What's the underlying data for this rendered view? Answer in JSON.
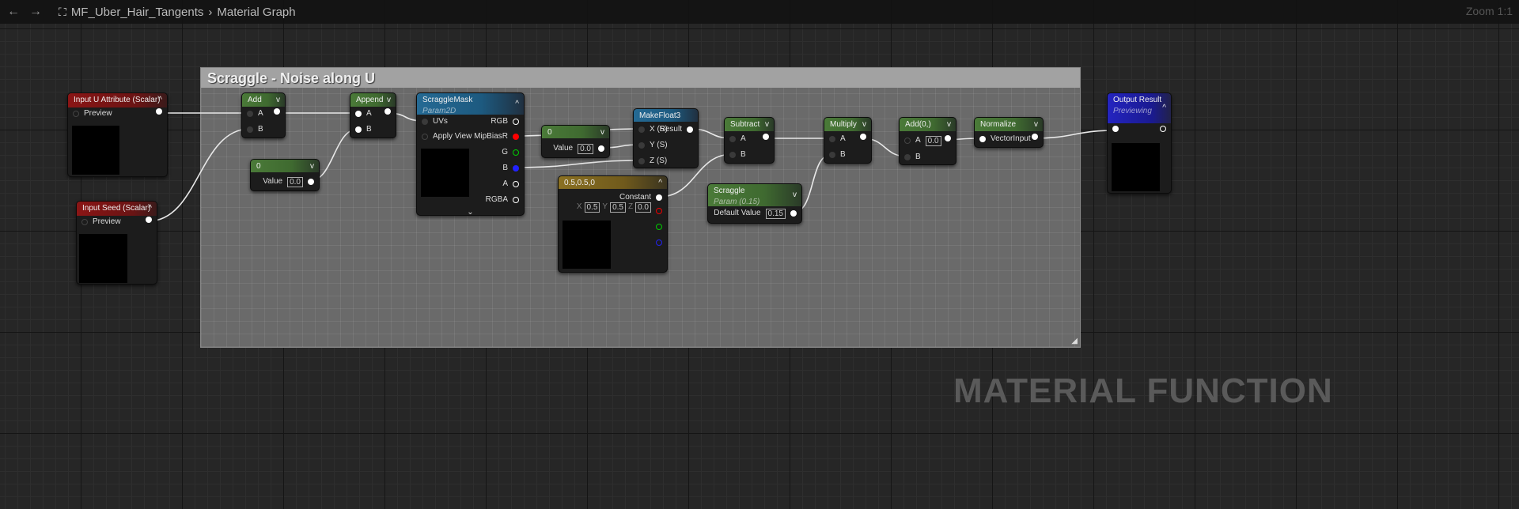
{
  "topbar": {
    "back_icon": "arrow-left",
    "forward_icon": "arrow-right",
    "graph_icon": "material-graph-icon",
    "asset": "MF_Uber_Hair_Tangents",
    "separator": "›",
    "graph": "Material Graph",
    "zoom": "Zoom 1:1"
  },
  "comment": {
    "title": "Scraggle - Noise along U"
  },
  "watermark": "MATERIAL FUNCTION",
  "colors": {
    "function_input": "#8a1515",
    "math": "#4a7a38",
    "texture_param": "#256a94",
    "constant3": "#8a7022",
    "output": "#2424c0"
  },
  "nodes": [
    {
      "id": "inU",
      "title": "Input U Attribute (Scalar)",
      "color": "red",
      "chev": "^",
      "preview": true,
      "rows": [
        {
          "l": {
            "pin": "empty",
            "label": "Preview"
          },
          "r": {
            "pin": "filled"
          }
        }
      ]
    },
    {
      "id": "inSeed",
      "title": "Input Seed (Scalar)",
      "color": "red",
      "chev": "^",
      "preview": true,
      "rows": [
        {
          "l": {
            "pin": "empty",
            "label": "Preview"
          },
          "r": {
            "pin": "filled"
          }
        }
      ]
    },
    {
      "id": "add",
      "title": "Add",
      "color": "green",
      "chev": "v",
      "rows": [
        {
          "l": {
            "pin": "dim",
            "label": "A"
          },
          "r": {
            "pin": "filled"
          }
        },
        {
          "l": {
            "pin": "dim",
            "label": "B"
          }
        }
      ]
    },
    {
      "id": "c0a",
      "title": "0",
      "color": "green",
      "chev": "v",
      "rows": [
        {
          "r": {
            "label": "Value",
            "value": "0.0",
            "pin": "filled"
          }
        }
      ]
    },
    {
      "id": "append",
      "title": "Append",
      "color": "green",
      "chev": "v",
      "rows": [
        {
          "l": {
            "pin": "filled",
            "label": "A"
          },
          "r": {
            "pin": "filled"
          }
        },
        {
          "l": {
            "pin": "filled",
            "label": "B"
          }
        }
      ]
    },
    {
      "id": "mask",
      "title": "ScraggleMask",
      "subtitle": "Param2D",
      "color": "blue",
      "chev": "^",
      "preview": true,
      "foot": "⌄",
      "rows": [
        {
          "l": {
            "pin": "dim",
            "label": "UVs"
          },
          "r": {
            "label": "RGB",
            "pin": "hollow"
          }
        },
        {
          "l": {
            "pin": "empty",
            "label": "Apply View MipBias"
          },
          "r": {
            "label": "R",
            "pin": "red"
          }
        },
        {
          "r": {
            "label": "G",
            "pin": "green-h"
          }
        },
        {
          "r": {
            "label": "B",
            "pin": "blue"
          }
        },
        {
          "r": {
            "label": "A",
            "pin": "hollow"
          }
        },
        {
          "r": {
            "label": "RGBA",
            "pin": "hollow"
          }
        }
      ]
    },
    {
      "id": "c0b",
      "title": "0",
      "color": "green",
      "chev": "v",
      "rows": [
        {
          "r": {
            "label": "Value",
            "value": "0.0",
            "pin": "filled"
          }
        }
      ]
    },
    {
      "id": "mf3",
      "title": "MakeFloat3",
      "color": "blue",
      "rows": [
        {
          "l": {
            "pin": "dim",
            "label": "X (S)"
          },
          "r": {
            "label": "Result",
            "pin": "filled"
          }
        },
        {
          "l": {
            "pin": "dim",
            "label": "Y (S)"
          }
        },
        {
          "l": {
            "pin": "dim",
            "label": "Z (S)"
          }
        }
      ]
    },
    {
      "id": "c3",
      "title": "0.5,0.5,0",
      "color": "gold",
      "chev": "^",
      "preview": true,
      "rows": [
        {
          "r": {
            "label": "Constant",
            "pin": "filled"
          }
        },
        {
          "r": {
            "vec": [
              [
                "X",
                "0.5"
              ],
              [
                "Y",
                "0.5"
              ],
              [
                "Z",
                "0.0"
              ]
            ]
          }
        },
        {
          "r": {
            "pin": "red-h"
          }
        },
        {
          "r": {
            "pin": "green-h"
          }
        },
        {
          "r": {
            "pin": "blue-h"
          }
        }
      ]
    },
    {
      "id": "sub",
      "title": "Subtract",
      "color": "green",
      "chev": "v",
      "rows": [
        {
          "l": {
            "pin": "dim",
            "label": "A"
          },
          "r": {
            "pin": "filled"
          }
        },
        {
          "l": {
            "pin": "dim",
            "label": "B"
          }
        }
      ]
    },
    {
      "id": "scr",
      "title": "Scraggle",
      "subtitle": "Param (0.15)",
      "color": "green",
      "chev": "v",
      "rows": [
        {
          "r": {
            "label": "Default Value",
            "value": "0.15",
            "pin": "filled"
          }
        }
      ]
    },
    {
      "id": "mul",
      "title": "Multiply",
      "color": "green",
      "chev": "v",
      "rows": [
        {
          "l": {
            "pin": "dim",
            "label": "A"
          },
          "r": {
            "pin": "filled"
          }
        },
        {
          "l": {
            "pin": "dim",
            "label": "B"
          }
        }
      ]
    },
    {
      "id": "add0",
      "title": "Add(0,)",
      "color": "green",
      "chev": "v",
      "rows": [
        {
          "l": {
            "pin": "empty",
            "label": "A",
            "value": "0.0"
          },
          "r": {
            "pin": "filled"
          }
        },
        {
          "l": {
            "pin": "dim",
            "label": "B"
          }
        }
      ]
    },
    {
      "id": "norm",
      "title": "Normalize",
      "color": "green",
      "chev": "v",
      "rows": [
        {
          "l": {
            "pin": "filled",
            "label": "VectorInput"
          },
          "r": {
            "pin": "filled"
          }
        }
      ]
    },
    {
      "id": "out",
      "title": "Output Result",
      "subtitle": "Previewing",
      "color": "outb",
      "chev": "^",
      "preview": true,
      "rows": [
        {
          "l": {
            "pin": "filled"
          },
          "r": {
            "pin": "hollow"
          }
        }
      ]
    }
  ]
}
